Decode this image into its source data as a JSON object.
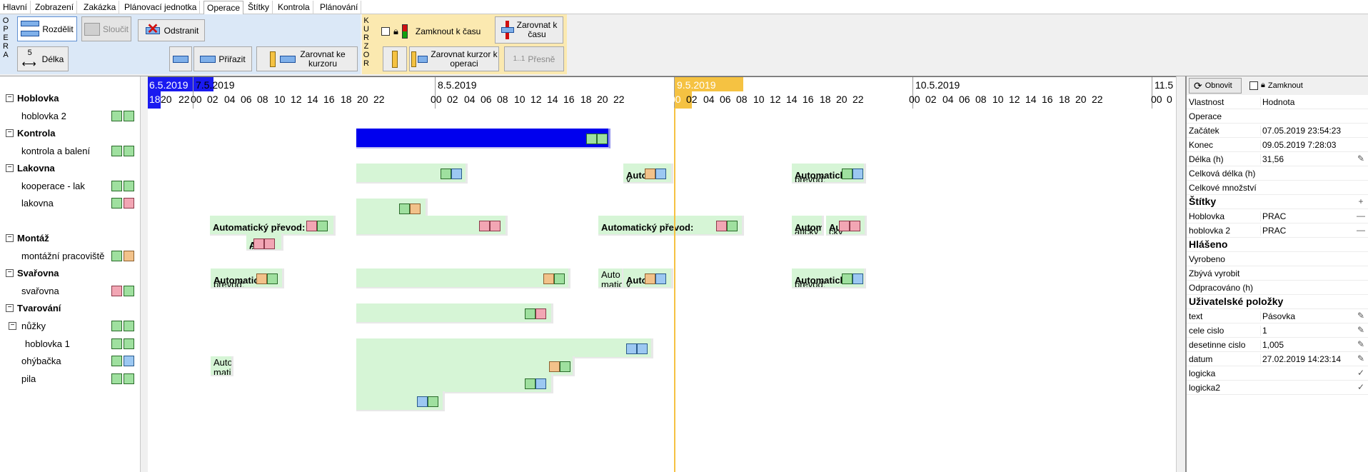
{
  "menu": {
    "tabs": [
      "Hlavní",
      "Zobrazení",
      "Zakázka",
      "Plánovací jednotka",
      "Operace",
      "Štítky",
      "Kontrola",
      "Plánování"
    ],
    "active_tab": "Operace"
  },
  "ribbon": {
    "operace_group_label": "OPERA",
    "kurzor_group_label": "KURZOR",
    "split_label": "Rozdělit",
    "merge_label": "Sloučit",
    "remove_label": "Odstranit",
    "length_label": "Délka",
    "length_icon_number": "5",
    "assign_label": "Přiřazit",
    "align_cursor_label_1": "Zarovnat ke",
    "align_cursor_label_2": "kurzoru",
    "lock_time_label": "Zamknout k času",
    "align_time_label_1": "Zarovnat k",
    "align_time_label_2": "času",
    "align_cursor_op_label_1": "Zarovnat kurzor k",
    "align_cursor_op_label_2": "operaci",
    "precise_label": "Přesně",
    "precise_icon_text": "1..1"
  },
  "tree": [
    {
      "label": "Hoblovka",
      "type": "group"
    },
    {
      "label": "hoblovka 2",
      "type": "item",
      "icons": [
        "green",
        "green"
      ]
    },
    {
      "label": "Kontrola",
      "type": "group"
    },
    {
      "label": "kontrola a balení",
      "type": "item",
      "icons": [
        "green",
        "green"
      ]
    },
    {
      "label": "Lakovna",
      "type": "group"
    },
    {
      "label": "kooperace - lak",
      "type": "item",
      "icons": [
        "green",
        "green"
      ]
    },
    {
      "label": "lakovna",
      "type": "item",
      "icons": [
        "green",
        "pink"
      ]
    },
    {
      "label": "",
      "type": "spacer"
    },
    {
      "label": "Montáž",
      "type": "group"
    },
    {
      "label": "montážní pracoviště",
      "type": "item",
      "icons": [
        "green",
        "orange"
      ]
    },
    {
      "label": "Svařovna",
      "type": "group"
    },
    {
      "label": "svařovna",
      "type": "item",
      "icons": [
        "pink",
        "green"
      ]
    },
    {
      "label": "Tvarování",
      "type": "group"
    },
    {
      "label": "nůžky",
      "type": "subgroup",
      "icons": [
        "green",
        "green"
      ]
    },
    {
      "label": "hoblovka 1",
      "type": "subitem",
      "icons": [
        "green",
        "green"
      ]
    },
    {
      "label": "ohýbačka",
      "type": "item",
      "icons": [
        "green",
        "blue"
      ]
    },
    {
      "label": "pila",
      "type": "item",
      "icons": [
        "green",
        "green"
      ]
    }
  ],
  "timeline": {
    "days": [
      "6.5.2019",
      "7.5.2019",
      "8.5.2019",
      "9.5.2019",
      "10.5.2019",
      "11.5"
    ],
    "hours_day6": [
      "18",
      "20",
      "22"
    ],
    "hours_full": [
      "00",
      "02",
      "04",
      "06",
      "08",
      "10",
      "12",
      "14",
      "16",
      "18",
      "20",
      "22"
    ],
    "hours_day11": [
      "00",
      "0"
    ]
  },
  "bars": {
    "auto": "Automatický převod:",
    "auto_short_1": "Automatick",
    "auto_short_2": "převod:",
    "auto_tiny_1": "Auto",
    "auto_tiny_2": "mati",
    "auto_tiny_3": "matic",
    "auto_split_1": "Auto",
    "auto_split_2": "k",
    "auto_split_3": "ý převod:",
    "autom_1": "Autom",
    "autom_2": "atický",
    "au_1": "Au",
    "au_2": "ti",
    "au_3": "cký přev",
    "ai_1": "Ai",
    "ai_2": "at",
    "ai_3": "ický pře"
  },
  "props": {
    "refresh_label": "Obnovit",
    "lock_label": "Zamknout",
    "header_key": "Vlastnost",
    "header_value": "Hodnota",
    "rows": [
      {
        "k": "Operace",
        "v": ""
      },
      {
        "k": "Začátek",
        "v": "07.05.2019 23:54:23"
      },
      {
        "k": "Konec",
        "v": "09.05.2019 7:28:03"
      },
      {
        "k": "Délka (h)",
        "v": "31,56",
        "action": "edit"
      },
      {
        "k": "Celková délka (h)",
        "v": ""
      },
      {
        "k": "Celkové množství",
        "v": ""
      }
    ],
    "tags_section": "Štítky",
    "tags": [
      {
        "k": "Hoblovka",
        "v": "PRAC",
        "action": "remove"
      },
      {
        "k": "hoblovka 2",
        "v": "PRAC",
        "action": "remove"
      }
    ],
    "report_section": "Hlášeno",
    "report_rows": [
      {
        "k": "Vyrobeno",
        "v": ""
      },
      {
        "k": "Zbývá vyrobit",
        "v": ""
      },
      {
        "k": "Odpracováno (h)",
        "v": ""
      }
    ],
    "user_section": "Uživatelské položky",
    "user_rows": [
      {
        "k": "text",
        "v": "Pásovka",
        "action": "edit"
      },
      {
        "k": "cele cislo",
        "v": "1",
        "action": "edit"
      },
      {
        "k": "desetinne cislo",
        "v": "1,005",
        "action": "edit"
      },
      {
        "k": "datum",
        "v": "27.02.2019 14:23:14",
        "action": "edit"
      },
      {
        "k": "logicka",
        "v": "",
        "action": "check"
      },
      {
        "k": "logicka2",
        "v": "",
        "action": "check"
      }
    ]
  },
  "colors": {
    "selected_bar": "#0000ee",
    "operation_bar": "#d6f5d6",
    "cursor": "#f5c242",
    "day6_highlight": "#1a1af0",
    "day9_highlight": "#f5c242"
  }
}
